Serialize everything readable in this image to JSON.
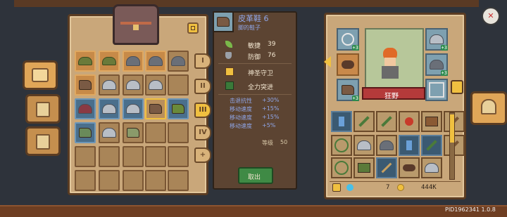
{
  "item": {
    "name": "皮革鞋 6",
    "subtitle": "脚的鞋子",
    "stats": [
      {
        "icon": "feather-icon",
        "label": "敏捷",
        "value": "39"
      },
      {
        "icon": "shield-icon",
        "label": "防御",
        "value": "76"
      }
    ],
    "skills": [
      {
        "icon": "holy-shield-icon",
        "label": "神圣守卫"
      },
      {
        "icon": "sprint-icon",
        "label": "全力突进"
      }
    ],
    "bonuses": [
      {
        "label": "击退抗性",
        "value": "+30%"
      },
      {
        "label": "移动速度",
        "value": "+15%"
      },
      {
        "label": "移动速度",
        "value": "+15%"
      },
      {
        "label": "移动速度",
        "value": "+5%"
      }
    ],
    "level_label": "等级",
    "level": "50",
    "equip_button": "取出"
  },
  "character": {
    "name": "狂野",
    "equip_bonus": "+3"
  },
  "inventory_tabs": [
    "I",
    "II",
    "III",
    "IV",
    "+"
  ],
  "active_tab": "III",
  "wallet": {
    "gems": "7",
    "coins": "444K"
  },
  "footer": {
    "build": "PID1962341 1.0.8"
  },
  "colors": {
    "panel": "#c9a77a",
    "tooltip": "#5c4432",
    "accent_gold": "#f0c040",
    "button_green": "#3f8a45"
  }
}
